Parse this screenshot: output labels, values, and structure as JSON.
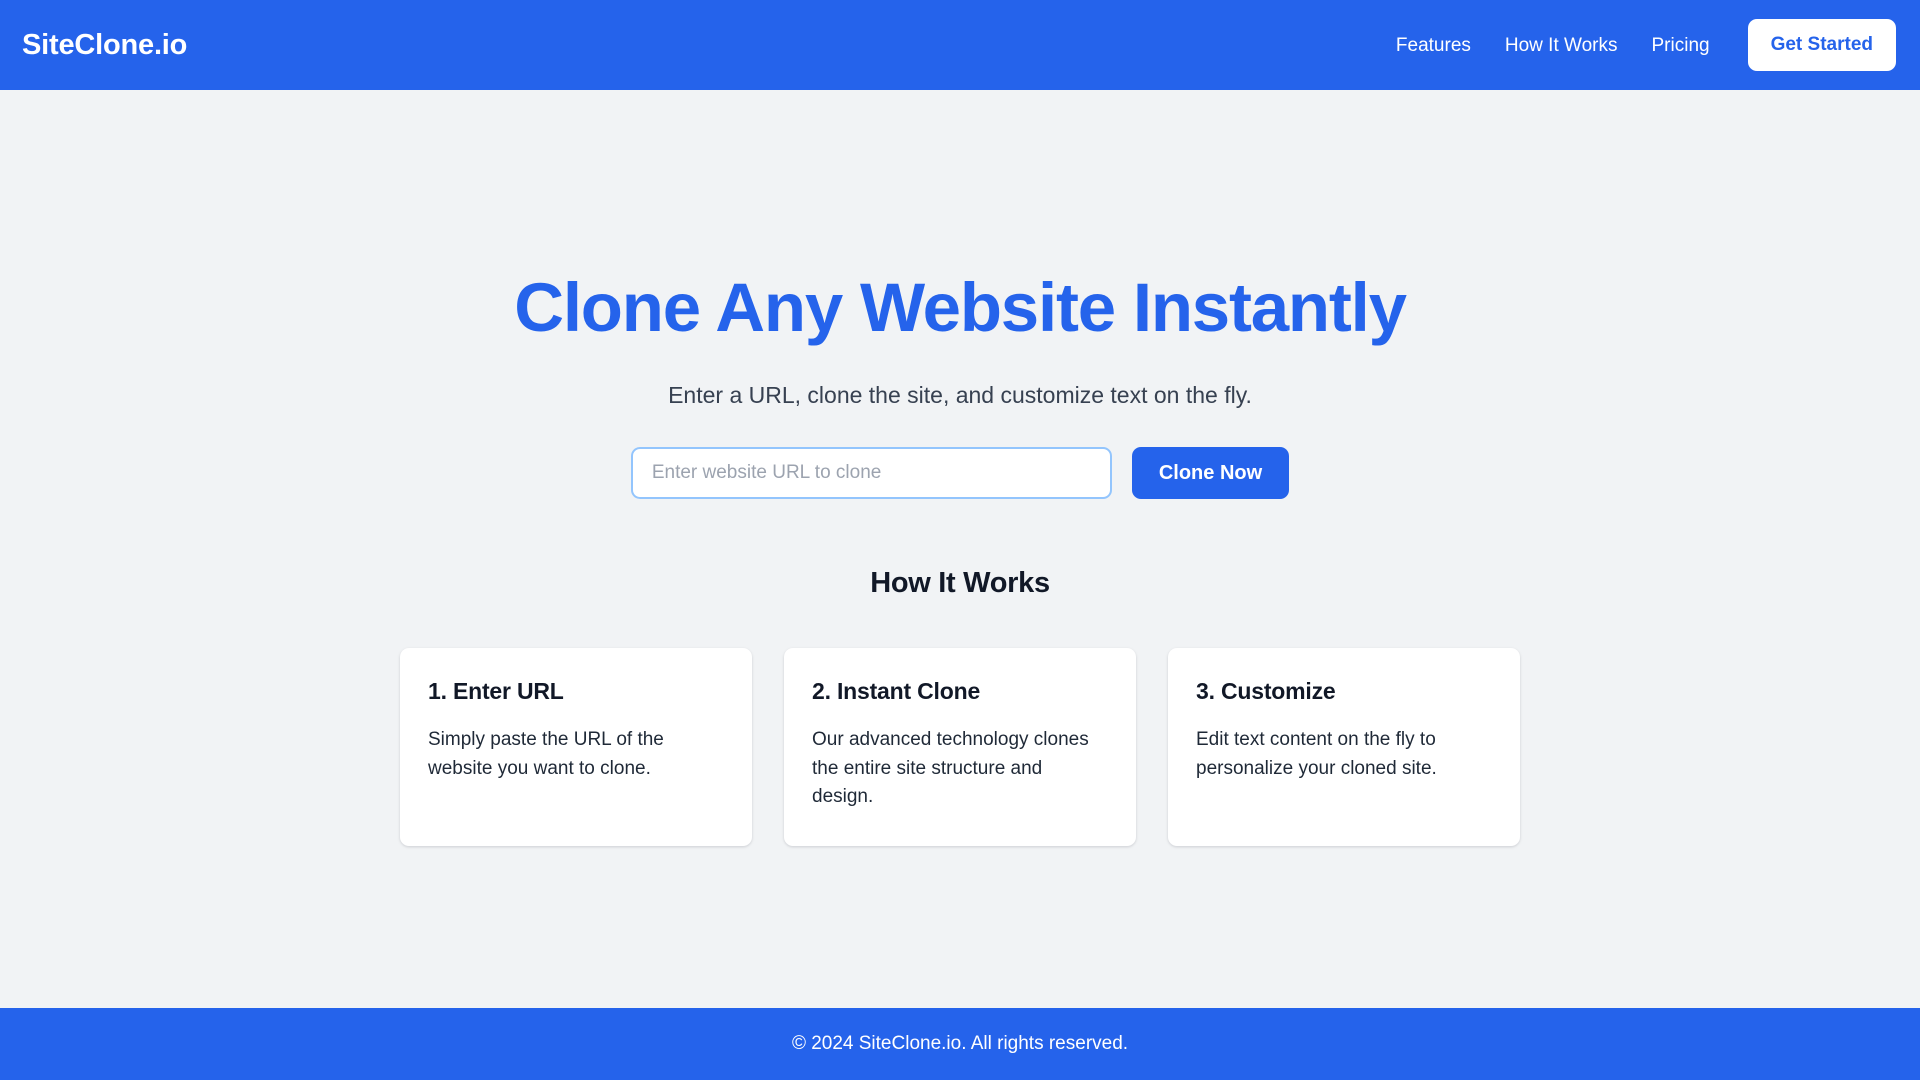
{
  "header": {
    "brand": "SiteClone.io",
    "nav_links": [
      {
        "label": "Features"
      },
      {
        "label": "How It Works"
      },
      {
        "label": "Pricing"
      }
    ],
    "cta_label": "Get Started",
    "background_color": "#2563eb",
    "cta_text_color": "#2563eb"
  },
  "hero": {
    "title": "Clone Any Website Instantly",
    "subtitle": "Enter a URL, clone the site, and customize text on the fly.",
    "title_color": "#2563eb",
    "input_value": "",
    "input_placeholder": "Enter website URL to clone",
    "submit_label": "Clone Now"
  },
  "how_it_works": {
    "title": "How It Works",
    "cards": [
      {
        "title": "1. Enter URL",
        "text": "Simply paste the URL of the website you want to clone."
      },
      {
        "title": "2. Instant Clone",
        "text": "Our advanced technology clones the entire site structure and design."
      },
      {
        "title": "3. Customize",
        "text": "Edit text content on the fly to personalize your cloned site."
      }
    ]
  },
  "footer": {
    "text": "© 2024 SiteClone.io. All rights reserved.",
    "background_color": "#2563eb"
  },
  "page": {
    "background_color": "#f1f3f5"
  }
}
